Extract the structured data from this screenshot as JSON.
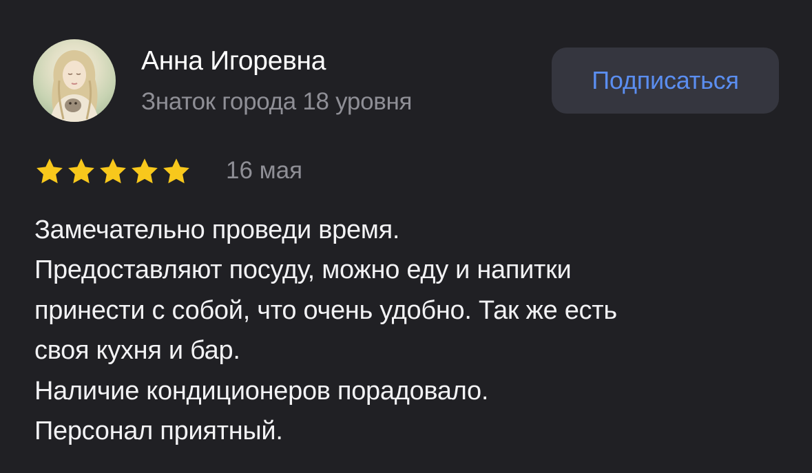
{
  "author": {
    "name": "Анна Игоревна",
    "level": "Знаток города 18 уровня",
    "avatar_icon": "user-avatar-photo"
  },
  "subscribe": {
    "label": "Подписаться",
    "color": "#5b8ef0",
    "background": "#35363f"
  },
  "review": {
    "rating": 5,
    "rating_max": 5,
    "star_color": "#f8c81c",
    "date": "16 мая",
    "lines": [
      "Замечательно проведи время.",
      "Предоставляют посуду, можно еду и напитки",
      "принести с собой, что очень удобно. Так же есть",
      "своя кухня и бар.",
      "Наличие кондиционеров порадовало.",
      "Персонал приятный."
    ]
  },
  "theme": {
    "background": "#202024",
    "text": "#f2f2f4",
    "muted": "#8f8f96"
  }
}
